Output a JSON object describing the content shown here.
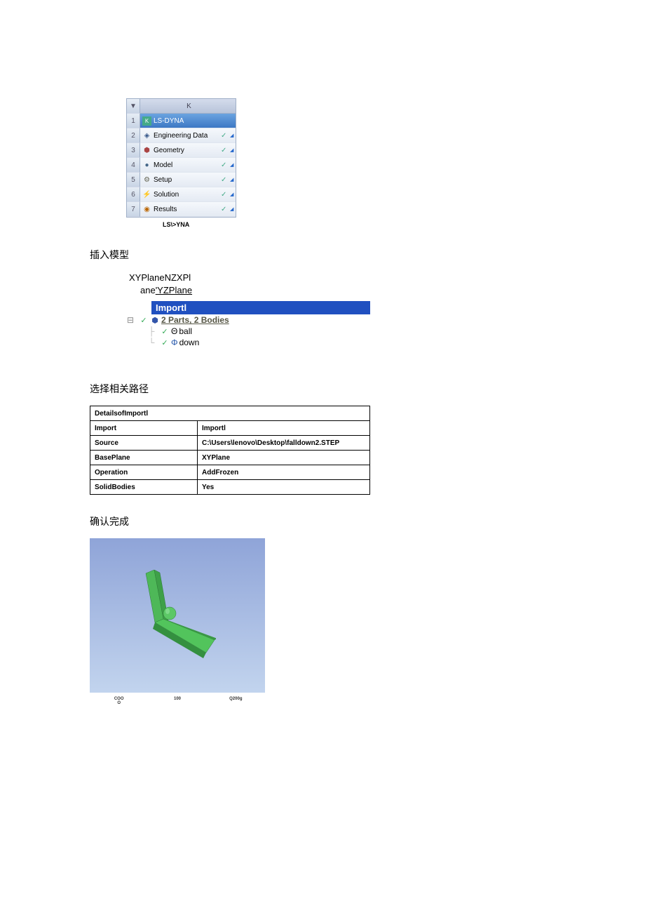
{
  "sysTable": {
    "headerDropdown": "▼",
    "headerLetter": "K",
    "caption": "LS\\>YNA",
    "rows": [
      {
        "n": "1",
        "label": "LS-DYNA",
        "selected": true,
        "check": false
      },
      {
        "n": "2",
        "label": "Engineering Data",
        "check": true
      },
      {
        "n": "3",
        "label": "Geometry",
        "check": true
      },
      {
        "n": "4",
        "label": "Model",
        "check": true
      },
      {
        "n": "5",
        "label": "Setup",
        "check": true
      },
      {
        "n": "6",
        "label": "Solution",
        "check": true
      },
      {
        "n": "7",
        "label": "Results",
        "check": true
      }
    ]
  },
  "h_insert": "插入模型",
  "tree1": {
    "line1": "XYPlaneNZXPl",
    "line2_pre": "ane",
    "line2_link": "'YZPlane",
    "import": "Importl",
    "parts": "2 Parts, 2 Bodies",
    "ball": "ball",
    "down": "down"
  },
  "h_select": "选择相关路径",
  "details": {
    "title": "DetailsofImportl",
    "rows": [
      {
        "k": "Import",
        "v": "Importl"
      },
      {
        "k": "Source",
        "v": "C:\\Users\\lenovo\\Desktop\\falldown2.STEP"
      },
      {
        "k": "BasePlane",
        "v": "XYPlane"
      },
      {
        "k": "Operation",
        "v": "AddFrozen"
      },
      {
        "k": "SolidBodies",
        "v": "Yes"
      }
    ]
  },
  "h_confirm": "确认完成",
  "scale": {
    "a": "COO",
    "a2": "O",
    "b": "100",
    "c": "Q200g"
  }
}
